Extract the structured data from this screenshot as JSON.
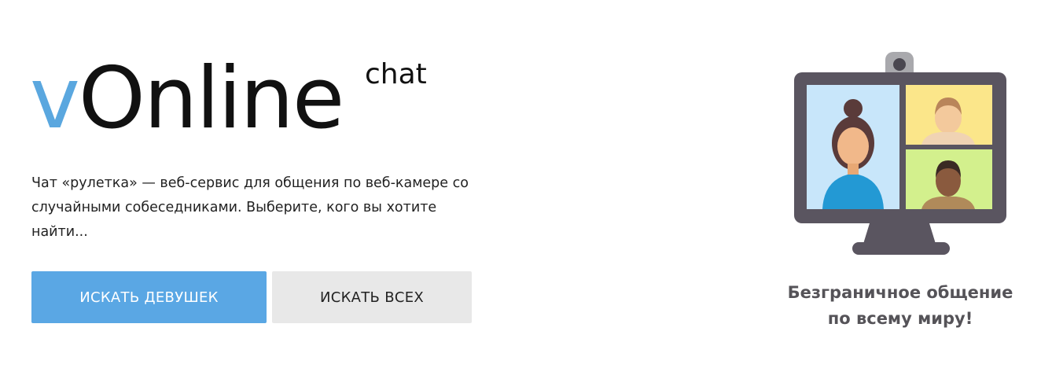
{
  "logo": {
    "v": "v",
    "online": "Online",
    "chat": "chat"
  },
  "description": "Чат «рулетка» — веб-сервис для общения по веб-камере со случайными собеседниками. Выберите, кого вы хотите найти...",
  "buttons": {
    "search_girls": "ИСКАТЬ ДЕВУШЕК",
    "search_all": "ИСКАТЬ ВСЕХ"
  },
  "tagline": "Безграничное общение по всему миру!",
  "illustration": {
    "icon": "video-call-monitor-icon"
  },
  "colors": {
    "accent": "#5aa7e4",
    "secondary_button": "#e8e8e8",
    "tagline": "#555358"
  }
}
